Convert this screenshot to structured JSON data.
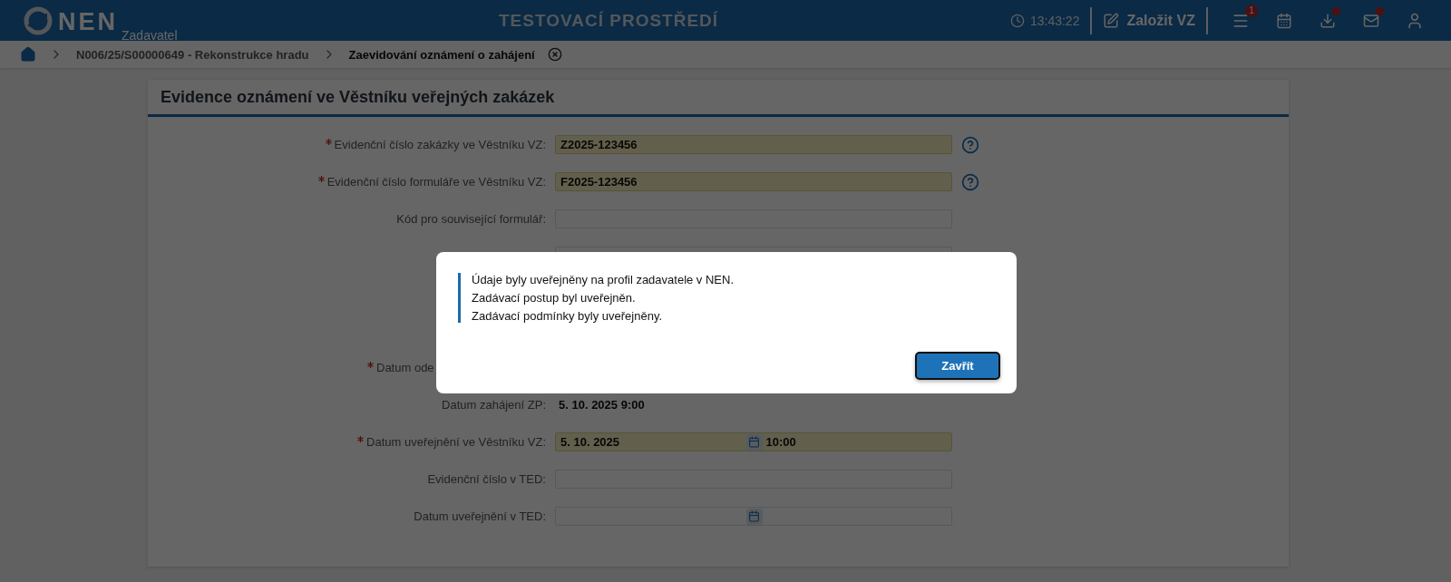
{
  "header": {
    "logo": {
      "name": "NEN",
      "subtitle": "Zadavatel"
    },
    "environment": "TESTOVACÍ PROSTŘEDÍ",
    "time": "13:43:22",
    "create_button": "Založit VZ",
    "toolbar": [
      {
        "kind": "menu",
        "badge": "1"
      },
      {
        "kind": "calendar"
      },
      {
        "kind": "download",
        "dot": true
      },
      {
        "kind": "mail",
        "dot": true
      },
      {
        "kind": "user"
      }
    ]
  },
  "breadcrumb": [
    {
      "label": "N006/25/S00000649 - Rekonstrukce hradu",
      "selected": false
    },
    {
      "label": "Zaevidování oznámení o zahájení",
      "selected": true
    }
  ],
  "panel": {
    "title": "Evidence oznámení ve Věstníku veřejných zakázek",
    "rows": [
      {
        "kind": "text",
        "label": "Evidenční číslo zakázky ve Věstníku VZ:",
        "required": true,
        "value": "Z2025-123456",
        "highlighted": true,
        "help": true
      },
      {
        "kind": "text",
        "label": "Evidenční číslo formuláře ve Věstníku VZ:",
        "required": true,
        "value": "F2025-123456",
        "highlighted": true,
        "help": true
      },
      {
        "kind": "text",
        "label": "Kód pro související formulář:",
        "highlighted": false
      },
      {
        "kind": "text",
        "highlighted": false
      },
      {
        "kind": "covered",
        "label": "Datum ode",
        "required": true
      },
      {
        "kind": "readonly",
        "label": "Datum zahájení ZP:",
        "value": "5. 10. 2025 9:00"
      },
      {
        "kind": "datetime",
        "label": "Datum uveřejnění ve Věstníku VZ:",
        "required": true,
        "date": "5. 10. 2025",
        "time": "10:00",
        "highlighted": true
      },
      {
        "kind": "text",
        "label": "Evidenční číslo v TED:",
        "highlighted": false
      },
      {
        "kind": "datetime",
        "label": "Datum uveřejnění v TED:",
        "highlighted": false
      }
    ]
  },
  "dialog": {
    "messages": [
      "Údaje byly uveřejněny na profil zadavatele v NEN.",
      "Zadávací postup byl uveřejněn.",
      "Zadávací podmínky byly uveřejněny."
    ],
    "button": "Zavřít"
  }
}
